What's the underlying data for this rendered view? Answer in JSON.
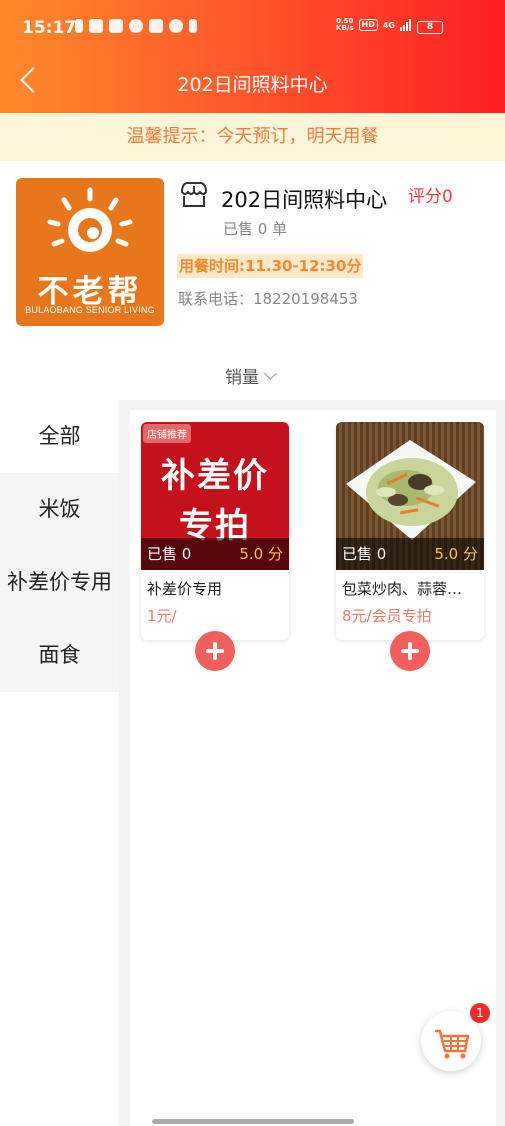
{
  "status_bar": {
    "time": "15:17",
    "net_speed_value": "0.50",
    "net_speed_unit": "KB/s",
    "hd": "HD",
    "network": "4G",
    "battery": "8"
  },
  "navbar": {
    "title": "202日间照料中心"
  },
  "notice": {
    "text": "温馨提示：今天预订，明天用餐"
  },
  "store": {
    "name": "202日间照料中心",
    "rating": "评分0",
    "sold": "已售 0 单",
    "meal_time": "用餐时间:11.30-12:30分",
    "phone": "联系电话：18220198453",
    "logo_cn": "不老帮",
    "logo_en": "BULAOBANG SENIOR LIVING"
  },
  "sort": {
    "label": "销量"
  },
  "categories": [
    "全部",
    "米饭",
    "补差价专用",
    "面食"
  ],
  "products": [
    {
      "badge": "店铺推荐",
      "image_line1": "补差价",
      "image_line2": "专拍",
      "sold": "已售 0",
      "score": "5.0 分",
      "name": "补差价专用",
      "price": "1元/"
    },
    {
      "sold": "已售 0",
      "score": "5.0 分",
      "name": "包菜炒肉、蒜蓉…",
      "price": "8元/会员专拍"
    }
  ],
  "cart": {
    "count": "1"
  },
  "colors": {
    "brand_red": "#ff1f24",
    "brand_orange": "#ff8a2a",
    "accent": "#f25f5c"
  }
}
